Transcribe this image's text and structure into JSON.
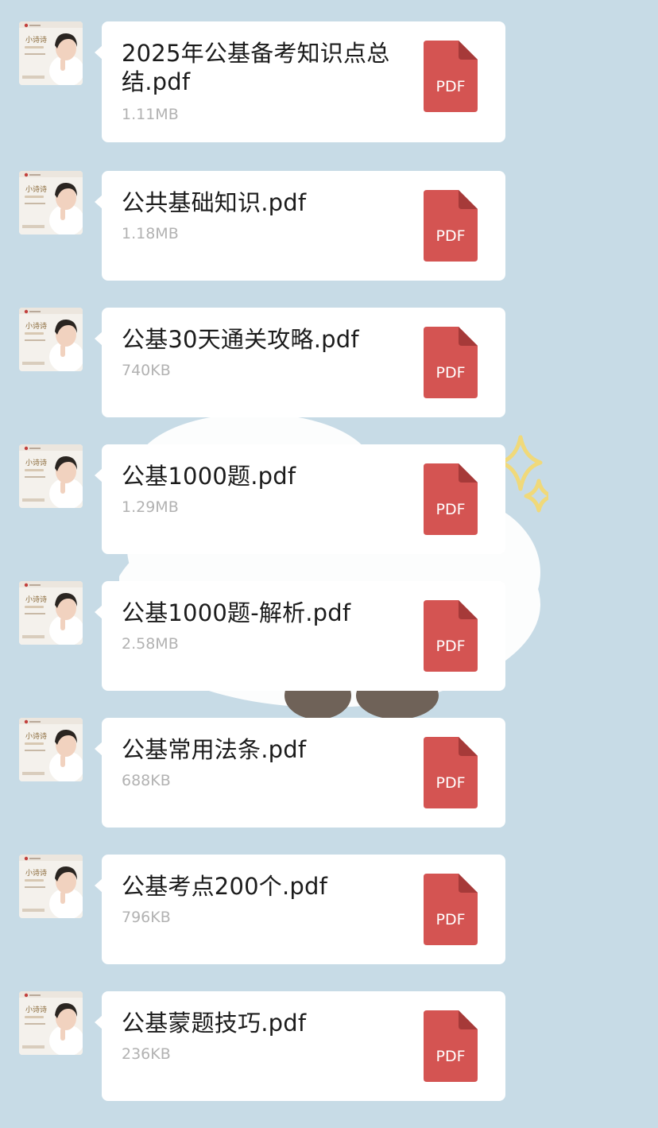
{
  "avatar": {
    "name_text": "小诗诗"
  },
  "file_icon_label": "PDF",
  "colors": {
    "background": "#c7dbe6",
    "bubble": "#ffffff",
    "pdf_icon": "#d45452",
    "pdf_fold": "#a63a39",
    "file_size_text": "#b2b2b2"
  },
  "messages": [
    {
      "file_name": "2025年公基备考知识点总结.pdf",
      "file_size": "1.11MB",
      "icon": "pdf-icon"
    },
    {
      "file_name": "公共基础知识.pdf",
      "file_size": "1.18MB",
      "icon": "pdf-icon"
    },
    {
      "file_name": "公基30天通关攻略.pdf",
      "file_size": "740KB",
      "icon": "pdf-icon"
    },
    {
      "file_name": "公基1000题.pdf",
      "file_size": "1.29MB",
      "icon": "pdf-icon"
    },
    {
      "file_name": "公基1000题-解析.pdf",
      "file_size": "2.58MB",
      "icon": "pdf-icon"
    },
    {
      "file_name": "公基常用法条.pdf",
      "file_size": "688KB",
      "icon": "pdf-icon"
    },
    {
      "file_name": "公基考点200个.pdf",
      "file_size": "796KB",
      "icon": "pdf-icon"
    },
    {
      "file_name": "公基蒙题技巧.pdf",
      "file_size": "236KB",
      "icon": "pdf-icon"
    }
  ]
}
